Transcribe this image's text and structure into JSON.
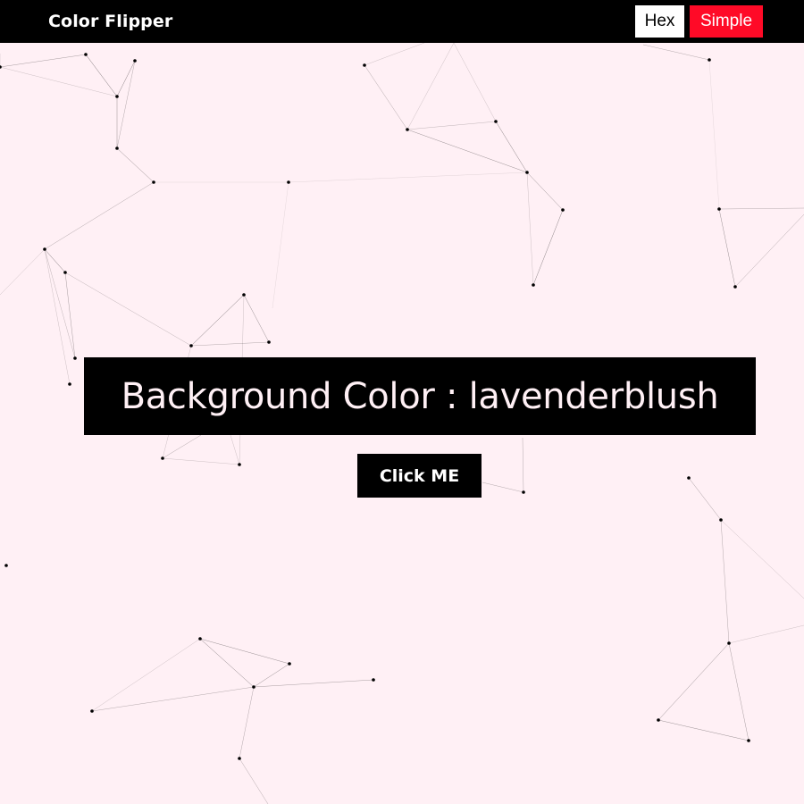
{
  "navbar": {
    "brand": "Color Flipper",
    "hex_label": "Hex",
    "simple_label": "Simple"
  },
  "main": {
    "label": "Background Color : ",
    "color_name": "lavenderblush",
    "button_label": "Click ME"
  },
  "colors": {
    "background": "#fff0f5",
    "navbar": "#000000",
    "hex_button": "#ffffff",
    "simple_button": "#ff0a27",
    "banner": "#000000",
    "banner_text": "#fff0f5"
  },
  "background_effect": "particle-network"
}
